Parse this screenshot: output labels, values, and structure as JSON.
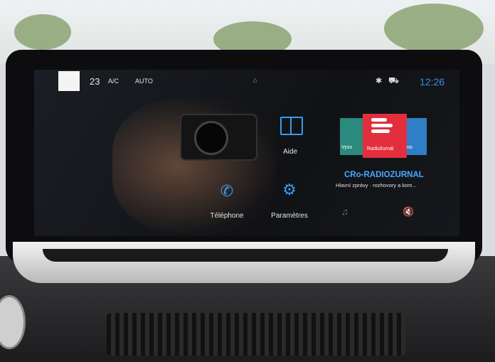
{
  "status_bar": {
    "temperature": "23",
    "ac_label": "A/C",
    "auto_label": "AUTO",
    "home_glyph": "⌂",
    "bluetooth_glyph": "✱",
    "car_glyph": "⛟",
    "time": "12:26"
  },
  "tiles": {
    "help": {
      "label": "Aide",
      "icon": "book-icon"
    },
    "phone": {
      "label": "Téléphone",
      "icon": "phone-icon",
      "glyph": "✆"
    },
    "settings": {
      "label": "Paramètres",
      "icon": "gear-icon",
      "glyph": "⚙"
    }
  },
  "radio": {
    "left_station_label": "Vyso",
    "center_station_label": "Radiožurnál",
    "right_station_label": "mo",
    "station_name": "CRo-RADIOZURNAL",
    "station_description": "Hlavní zprávy · rozhovory a kom...",
    "music_glyph": "♫",
    "mute_glyph": "🔇"
  },
  "colors": {
    "accent": "#3a9bf0",
    "radio_red": "#e32e3e",
    "radio_teal": "#2a8a7e",
    "radio_blue": "#2f7fc7"
  }
}
